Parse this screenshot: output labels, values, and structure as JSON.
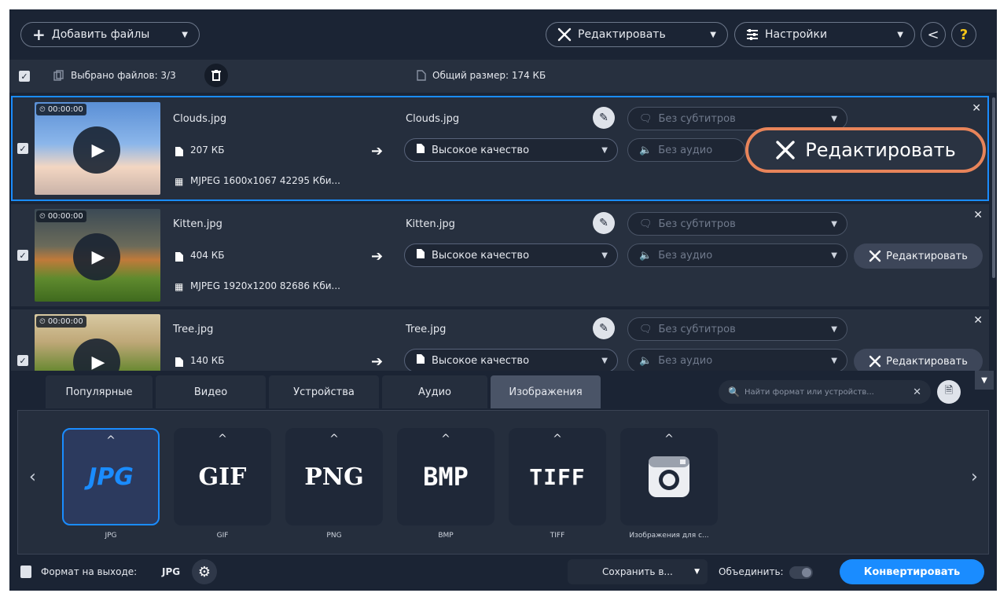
{
  "toolbar": {
    "add_files": "Добавить файлы",
    "edit": "Редактировать",
    "settings": "Настройки",
    "help": "?"
  },
  "selection": {
    "selected": "Выбрано файлов: 3/3",
    "total_size": "Общий размер: 174 КБ"
  },
  "files": [
    {
      "time": "00:00:00",
      "name": "Clouds.jpg",
      "size": "207 КБ",
      "meta": "MJPEG 1600x1067 42295 Кби...",
      "out_name": "Clouds.jpg",
      "quality": "Высокое качество",
      "subtitles": "Без субтитров",
      "audio": "Без аудио",
      "edit": "Редактировать"
    },
    {
      "time": "00:00:00",
      "name": "Kitten.jpg",
      "size": "404 КБ",
      "meta": "MJPEG 1920x1200 82686 Кби...",
      "out_name": "Kitten.jpg",
      "quality": "Высокое качество",
      "subtitles": "Без субтитров",
      "audio": "Без аудио",
      "edit": "Редактировать"
    },
    {
      "time": "00:00:00",
      "name": "Tree.jpg",
      "size": "140 КБ",
      "out_name": "Tree.jpg",
      "quality": "Высокое качество",
      "subtitles": "Без субтитров",
      "audio": "Без аудио",
      "edit": "Редактировать"
    }
  ],
  "tabs": [
    "Популярные",
    "Видео",
    "Устройства",
    "Аудио",
    "Изображения"
  ],
  "search_placeholder": "Найти формат или устройств...",
  "formats": [
    {
      "label": "JPG",
      "logo": "JPG"
    },
    {
      "label": "GIF",
      "logo": "GIF"
    },
    {
      "label": "PNG",
      "logo": "PNG"
    },
    {
      "label": "BMP",
      "logo": "BMP"
    },
    {
      "label": "TIFF",
      "logo": "TIFF"
    },
    {
      "label": "Изображения для с..."
    }
  ],
  "bottom": {
    "output_format_label": "Формат на выходе:",
    "output_format_value": "JPG",
    "save_to": "Сохранить в...",
    "merge": "Объединить:",
    "convert": "Конвертировать"
  },
  "colors": {
    "accent": "#1a8cff",
    "highlight": "#e8845a",
    "help": "#f5c518",
    "convert": "#1a8cff"
  }
}
